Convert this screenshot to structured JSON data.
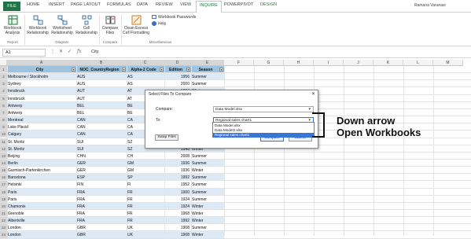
{
  "tabs": [
    "FILE",
    "HOME",
    "INSERT",
    "PAGE LAYOUT",
    "FORMULAS",
    "DATA",
    "REVIEW",
    "VIEW",
    "INQUIRE",
    "POWERPIVOT",
    "DESIGN"
  ],
  "user": "Ramana Varanasi",
  "ribbon": {
    "buttons": [
      "Workbook Analysis",
      "Workbook Relationship",
      "Worksheet Relationship",
      "Cell Relationship",
      "Compare Files",
      "Clean Excess Cell Formatting"
    ],
    "small": [
      "Workbook Passwords",
      "Help"
    ],
    "groups": [
      "Report",
      "Diagram",
      "Compare",
      "Miscellaneous"
    ]
  },
  "formula_bar": {
    "name_box": "A1",
    "value": "City"
  },
  "columns": [
    "A",
    "B",
    "C",
    "D",
    "E",
    "F",
    "G",
    "H",
    "I",
    "J",
    "K",
    "L",
    "M"
  ],
  "headers": [
    "City",
    "NOC_CountryRegion",
    "Alpha-2 Code",
    "Edition",
    "Season"
  ],
  "rows": [
    [
      "Melbourne / Stockholm",
      "AUS",
      "AS",
      "1956",
      "Summer"
    ],
    [
      "Sydney",
      "AUS",
      "AS",
      "2000",
      "Summer"
    ],
    [
      "Innsbruck",
      "AUT",
      "AT",
      "1964",
      "Winter"
    ],
    [
      "Innsbruck",
      "AUT",
      "AT",
      "1976",
      "Winter"
    ],
    [
      "Antwerp",
      "BEL",
      "BE",
      "1920",
      "Summer"
    ],
    [
      "Antwerp",
      "BEL",
      "BE",
      "1920",
      "Winter"
    ],
    [
      "Montreal",
      "CAN",
      "CA",
      "1976",
      "Summer"
    ],
    [
      "Lake Placid",
      "CAN",
      "CA",
      "1980",
      "Winter"
    ],
    [
      "Calgary",
      "CAN",
      "CA",
      "1988",
      "Winter"
    ],
    [
      "St. Moritz",
      "SUI",
      "SZ",
      "1928",
      "Winter"
    ],
    [
      "St. Moritz",
      "SUI",
      "SZ",
      "1948",
      "Winter"
    ],
    [
      "Beijing",
      "CHN",
      "CH",
      "2008",
      "Summer"
    ],
    [
      "Berlin",
      "GER",
      "GM",
      "1936",
      "Summer"
    ],
    [
      "Garmisch-Partenkirchen",
      "GER",
      "GM",
      "1936",
      "Winter"
    ],
    [
      "Barcelona",
      "ESP",
      "SP",
      "1992",
      "Summer"
    ],
    [
      "Helsinki",
      "FIN",
      "FI",
      "1952",
      "Summer"
    ],
    [
      "Paris",
      "FRA",
      "FR",
      "1900",
      "Summer"
    ],
    [
      "Paris",
      "FRA",
      "FR",
      "1924",
      "Summer"
    ],
    [
      "Chamonix",
      "FRA",
      "FR",
      "1924",
      "Winter"
    ],
    [
      "Grenoble",
      "FRA",
      "FR",
      "1968",
      "Winter"
    ],
    [
      "Albertville",
      "FRA",
      "FR",
      "1992",
      "Winter"
    ],
    [
      "London",
      "GBR",
      "UK",
      "1908",
      "Summer"
    ],
    [
      "London",
      "GBR",
      "UK",
      "1908",
      "Winter"
    ]
  ],
  "dialog": {
    "title": "Select Files To Compare",
    "compare_label": "Compare:",
    "compare_value": "Data Model.xlsx",
    "to_label": "To:",
    "to_value": "Regional sales chart1",
    "options": [
      "Data Model.xlsx",
      "Data Model2.xlsx",
      "Regional sales chart1"
    ],
    "swap": "Swap Files",
    "compare_btn": "Compare",
    "cancel_btn": "Cancel"
  },
  "annotation": {
    "line1": "Down arrow",
    "line2": "Open Workbooks"
  }
}
